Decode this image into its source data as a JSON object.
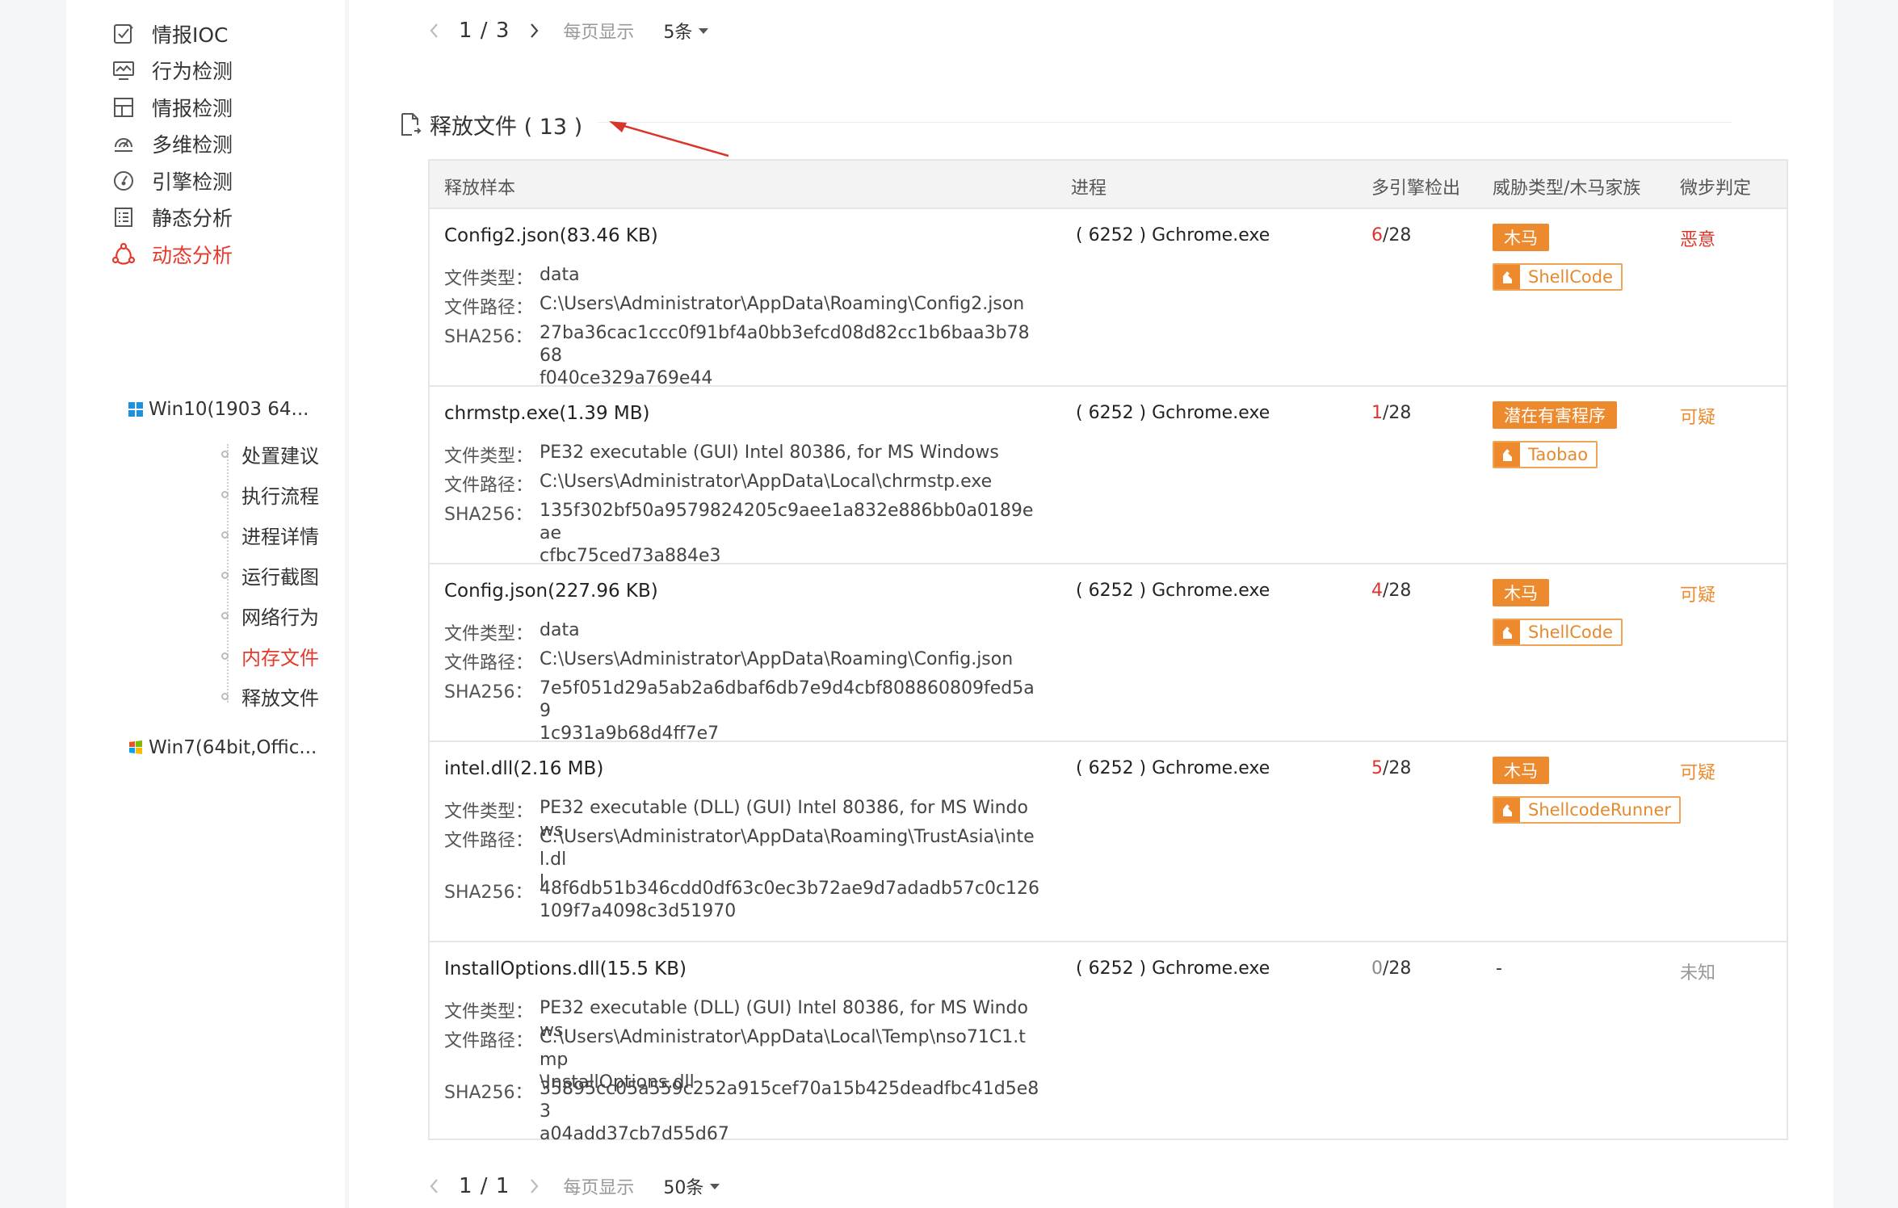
{
  "sidebar": {
    "nav": [
      {
        "label": "情报IOC",
        "icon": "edit-check-icon"
      },
      {
        "label": "行为检测",
        "icon": "monitor-chart-icon"
      },
      {
        "label": "情报检测",
        "icon": "layout-grid-icon"
      },
      {
        "label": "多维检测",
        "icon": "radar-icon"
      },
      {
        "label": "引擎检测",
        "icon": "gauge-icon"
      },
      {
        "label": "静态分析",
        "icon": "list-doc-icon"
      },
      {
        "label": "动态分析",
        "icon": "network-nodes-icon"
      }
    ],
    "groups": [
      {
        "label": "Win10(1903 64...",
        "icon": "windows10-icon",
        "expanded": true
      },
      {
        "label": "Win7(64bit,Offic...",
        "icon": "windows7-icon",
        "expanded": false
      }
    ],
    "sub_items": [
      "处置建议",
      "执行流程",
      "进程详情",
      "运行截图",
      "网络行为",
      "内存文件",
      "释放文件"
    ],
    "active_sub": "内存文件"
  },
  "pager_top": {
    "page": "1 / 3",
    "per_page_label": "每页显示",
    "size": "5条"
  },
  "pager_bottom": {
    "page": "1 / 1",
    "per_page_label": "每页显示",
    "size": "50条"
  },
  "section": {
    "title": "释放文件 ( 13 )"
  },
  "table": {
    "headers": [
      "释放样本",
      "进程",
      "多引擎检出",
      "威胁类型/木马家族",
      "微步判定"
    ],
    "labels": {
      "type": "文件类型：",
      "path": "文件路径：",
      "sha": "SHA256："
    },
    "rows": [
      {
        "name": "Config2.json(83.46 KB)",
        "type": "data",
        "path": "C:\\Users\\Administrator\\AppData\\Roaming\\Config2.json",
        "sha_1": "27ba36cac1ccc0f91bf4a0bb3efcd08d82cc1b6baa3b7868",
        "sha_2": "f040ce329a769e44",
        "process": "( 6252 ) Gchrome.exe",
        "det_num": "6",
        "det_total": "/28",
        "threat": "木马",
        "family": "ShellCode",
        "verdict": "恶意",
        "verdict_color": "#d9362b"
      },
      {
        "name": "chrmstp.exe(1.39 MB)",
        "type": "PE32 executable (GUI) Intel 80386, for MS Windows",
        "path": "C:\\Users\\Administrator\\AppData\\Local\\chrmstp.exe",
        "sha_1": "135f302bf50a9579824205c9aee1a832e886bb0a0189eae",
        "sha_2": "cfbc75ced73a884e3",
        "process": "( 6252 ) Gchrome.exe",
        "det_num": "1",
        "det_total": "/28",
        "threat": "潜在有害程序",
        "family": "Taobao",
        "verdict": "可疑",
        "verdict_color": "#ec8a2d"
      },
      {
        "name": "Config.json(227.96 KB)",
        "type": "data",
        "path": "C:\\Users\\Administrator\\AppData\\Roaming\\Config.json",
        "sha_1": "7e5f051d29a5ab2a6dbaf6db7e9d4cbf808860809fed5a9",
        "sha_2": "1c931a9b68d4ff7e7",
        "process": "( 6252 ) Gchrome.exe",
        "det_num": "4",
        "det_total": "/28",
        "threat": "木马",
        "family": "ShellCode",
        "verdict": "可疑",
        "verdict_color": "#ec8a2d"
      },
      {
        "name": "intel.dll(2.16 MB)",
        "type": "PE32 executable (DLL) (GUI) Intel 80386, for MS Windows",
        "path_1": "C:\\Users\\Administrator\\AppData\\Roaming\\TrustAsia\\intel.dl",
        "path_2": "l",
        "sha_1": "48f6db51b346cdd0df63c0ec3b72ae9d7adadb57c0c126",
        "sha_2": "109f7a4098c3d51970",
        "process": "( 6252 ) Gchrome.exe",
        "det_num": "5",
        "det_total": "/28",
        "threat": "木马",
        "family": "ShellcodeRunner",
        "verdict": "可疑",
        "verdict_color": "#ec8a2d"
      },
      {
        "name": "InstallOptions.dll(15.5 KB)",
        "type": "PE32 executable (DLL) (GUI) Intel 80386, for MS Windows",
        "path_1": "C:\\Users\\Administrator\\AppData\\Local\\Temp\\nso71C1.tmp",
        "path_2": "\\InstallOptions.dll",
        "sha_1": "35895cc05a559c252a915cef70a15b425deadfbc41d5e83",
        "sha_2": "a04add37cb7d55d67",
        "process": "( 6252 ) Gchrome.exe",
        "det_num": "0",
        "det_total": "/28",
        "threat_dash": "-",
        "verdict": "未知",
        "verdict_color": "#999999"
      }
    ]
  }
}
